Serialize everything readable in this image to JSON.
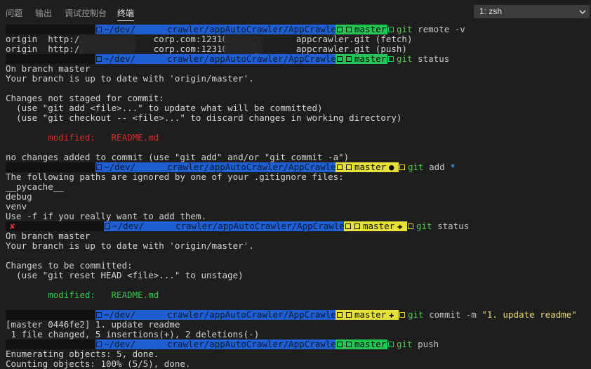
{
  "panel": {
    "tabs": [
      "问题",
      "输出",
      "调试控制台",
      "终端"
    ],
    "active_tab": "终端",
    "terminal_select": "1: zsh"
  },
  "prompt": {
    "path_prefix": "~/dev/",
    "path_suffix": "crawler/appAutoCrawler/AppCrawler",
    "branch": "master",
    "dirty_dot": "●",
    "staged_plus": "✚",
    "error_mark": "✘",
    "colors": {
      "path_bg": "#1f5fd1",
      "clean_bg": "#23c552",
      "dirty_bg": "#e5e13a"
    }
  },
  "blocks": [
    {
      "prompt_cmd": {
        "git": "git",
        "rest": " remote -v"
      },
      "output": [
        "origin  http://             corp.com:12310/data_       appcrawler.git (fetch)",
        "origin  http://             corp.com:12310/data_       appcrawler.git (push)"
      ]
    },
    {
      "prompt_cmd": {
        "git": "git",
        "rest": " status"
      },
      "output": [
        "On branch master",
        "Your branch is up to date with 'origin/master'.",
        "",
        "Changes not staged for commit:",
        "  (use \"git add <file>...\" to update what will be committed)",
        "  (use \"git checkout -- <file>...\" to discard changes in working directory)",
        "",
        "        modified:   README.md",
        "",
        "no changes added to commit (use \"git add\" and/or \"git commit -a\")"
      ]
    },
    {
      "prompt_cmd": {
        "git": "git",
        "rest": " add ",
        "star": "*"
      },
      "output": [
        "The following paths are ignored by one of your .gitignore files:",
        "__pycache__",
        "debug",
        "venv",
        "Use -f if you really want to add them."
      ]
    },
    {
      "prompt_cmd": {
        "git": "git",
        "rest": " status"
      },
      "output": [
        "On branch master",
        "Your branch is up to date with 'origin/master'.",
        "",
        "Changes to be committed:",
        "  (use \"git reset HEAD <file>...\" to unstage)",
        "",
        "        modified:   README.md",
        ""
      ]
    },
    {
      "prompt_cmd": {
        "git": "git",
        "rest": " commit -m ",
        "str": "\"1. update readme\""
      },
      "output": [
        "[master 0446fe2] 1. update readme",
        " 1 file changed, 5 insertions(+), 2 deletions(-)"
      ]
    },
    {
      "prompt_cmd": {
        "git": "git",
        "rest": " push"
      },
      "output": [
        "Enumerating objects: 5, done.",
        "Counting objects: 100% (5/5), done."
      ]
    }
  ],
  "modified_label": "modified:",
  "modified_file": "README.md"
}
